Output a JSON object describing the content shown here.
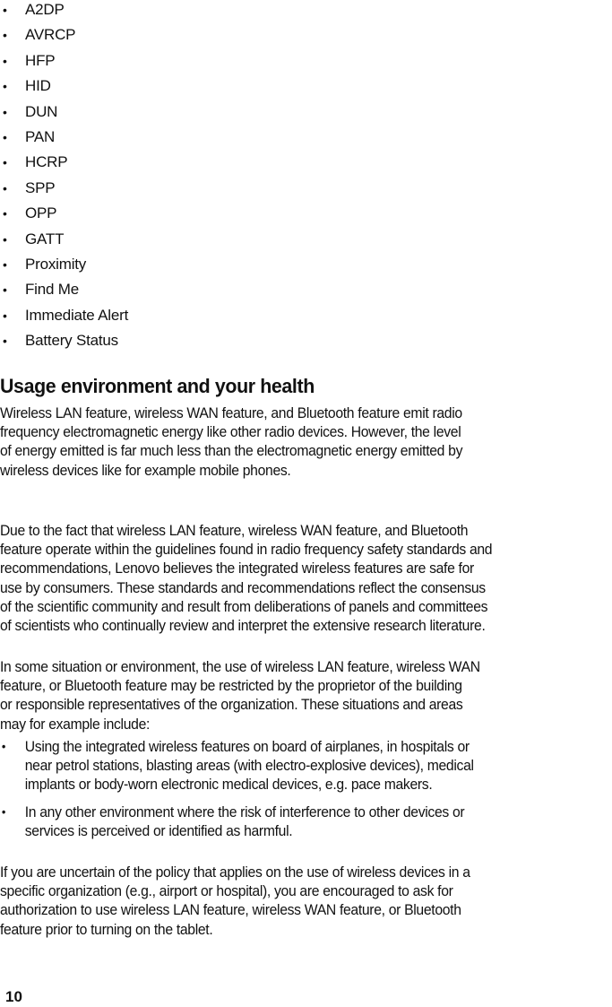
{
  "profiles_list": [
    "A2DP",
    "AVRCP",
    "HFP",
    "HID",
    "DUN",
    "PAN",
    "HCRP",
    "SPP",
    "OPP",
    "GATT",
    "Proximity",
    "Find Me",
    "Immediate Alert",
    "Battery Status"
  ],
  "section": {
    "heading": "Usage environment and your health",
    "paragraph1": [
      "Wireless LAN feature, wireless WAN feature, and Bluetooth feature emit radio",
      "frequency electromagnetic energy like other radio devices.  However, the level",
      "of energy emitted is far much less than the electromagnetic energy emitted by",
      "wireless devices like for example mobile phones."
    ],
    "paragraph2": [
      "Due to the fact that wireless LAN feature, wireless WAN feature, and Bluetooth",
      "feature operate within the guidelines found in radio frequency safety standards and",
      "recommendations, Lenovo believes the integrated wireless features are safe for",
      "use by consumers. These standards and recommendations reflect the consensus",
      "of the scientific community and result from deliberations of panels and committees",
      "of scientists who continually review and interpret the extensive research literature."
    ],
    "paragraph3": [
      "In some situation or environment, the use of wireless LAN feature, wireless WAN",
      "feature, or Bluetooth feature may be restricted by the proprietor of the building",
      "or responsible representatives of the organization.  These situations and areas",
      "may for example include:"
    ],
    "restrictions": [
      [
        "Using the integrated wireless features on board of airplanes, in hospitals or",
        "near petrol stations, blasting areas (with electro-explosive devices), medical",
        "implants or body-worn electronic medical devices, e.g.  pace makers."
      ],
      [
        "In any other environment where the risk of interference to other devices or",
        "services is perceived or identified as harmful."
      ]
    ],
    "paragraph4": [
      "If you are uncertain of the policy that applies on the use of wireless devices in a",
      "specific organization (e.g., airport or hospital), you are encouraged to ask for",
      "authorization to use wireless LAN feature, wireless WAN feature, or Bluetooth",
      "feature prior to turning on the tablet."
    ]
  },
  "footer": {
    "page_number": "10"
  },
  "bullet_glyph": "•"
}
